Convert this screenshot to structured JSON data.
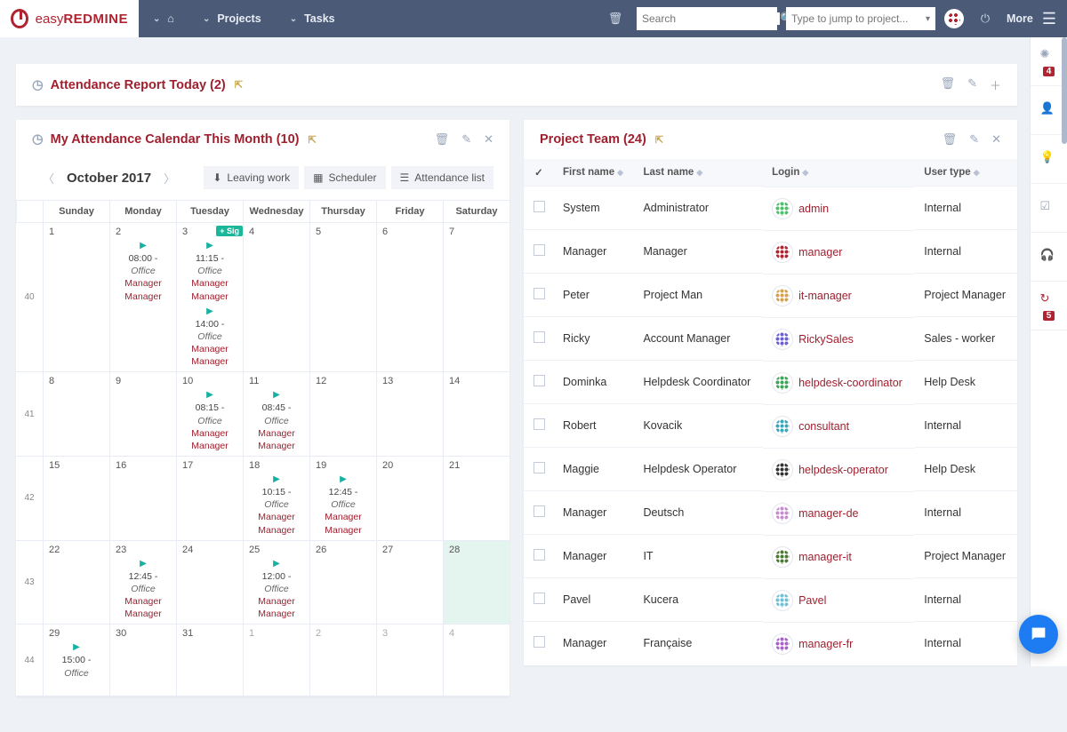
{
  "topbar": {
    "logo_easy": "easy",
    "logo_red": "REDMINE",
    "menu": [
      "Projects",
      "Tasks"
    ],
    "search_placeholder": "Search",
    "jump_placeholder": "Type to jump to project...",
    "more": "More"
  },
  "rightrail_badges": {
    "activity": "4",
    "time": "5"
  },
  "panelA": {
    "title": "Attendance Report Today (2)"
  },
  "panelCal": {
    "title": "My Attendance Calendar This Month (10)",
    "month": "October 2017",
    "btn_leaving": "Leaving work",
    "btn_scheduler": "Scheduler",
    "btn_list": "Attendance list",
    "dayhead": [
      "Sunday",
      "Monday",
      "Tuesday",
      "Wednesday",
      "Thursday",
      "Friday",
      "Saturday"
    ],
    "weeks": [
      {
        "wk": "40",
        "cells": [
          {
            "d": "1"
          },
          {
            "d": "2",
            "ev": [
              {
                "t": "08:00",
                "role": "Office",
                "who": "Manager Manager"
              }
            ]
          },
          {
            "d": "3",
            "pill": "+ Sig",
            "ev": [
              {
                "t": "11:15",
                "role": "Office",
                "who": "Manager Manager"
              },
              {
                "t": "14:00",
                "role": "Office",
                "who": "Manager Manager"
              }
            ]
          },
          {
            "d": "4"
          },
          {
            "d": "5"
          },
          {
            "d": "6"
          },
          {
            "d": "7"
          }
        ]
      },
      {
        "wk": "41",
        "cells": [
          {
            "d": "8"
          },
          {
            "d": "9"
          },
          {
            "d": "10",
            "ev": [
              {
                "t": "08:15",
                "role": "Office",
                "who": "Manager Manager"
              }
            ]
          },
          {
            "d": "11",
            "ev": [
              {
                "t": "08:45",
                "role": "Office",
                "who": "Manager Manager"
              }
            ]
          },
          {
            "d": "12"
          },
          {
            "d": "13"
          },
          {
            "d": "14"
          }
        ]
      },
      {
        "wk": "42",
        "cells": [
          {
            "d": "15"
          },
          {
            "d": "16"
          },
          {
            "d": "17"
          },
          {
            "d": "18",
            "ev": [
              {
                "t": "10:15",
                "role": "Office",
                "who": "Manager Manager"
              }
            ]
          },
          {
            "d": "19",
            "ev": [
              {
                "t": "12:45",
                "role": "Office",
                "who": "Manager Manager"
              }
            ]
          },
          {
            "d": "20"
          },
          {
            "d": "21"
          }
        ]
      },
      {
        "wk": "43",
        "cells": [
          {
            "d": "22"
          },
          {
            "d": "23",
            "ev": [
              {
                "t": "12:45",
                "role": "Office",
                "who": "Manager Manager"
              }
            ]
          },
          {
            "d": "24"
          },
          {
            "d": "25",
            "ev": [
              {
                "t": "12:00",
                "role": "Office",
                "who": "Manager Manager"
              }
            ]
          },
          {
            "d": "26"
          },
          {
            "d": "27"
          },
          {
            "d": "28",
            "fill": true
          }
        ]
      },
      {
        "wk": "44",
        "cells": [
          {
            "d": "29",
            "ev": [
              {
                "t": "15:00",
                "role": "Office",
                "who": ""
              }
            ]
          },
          {
            "d": "30"
          },
          {
            "d": "31"
          },
          {
            "d": "1",
            "past": true
          },
          {
            "d": "2",
            "past": true
          },
          {
            "d": "3",
            "past": true
          },
          {
            "d": "4",
            "past": true
          }
        ]
      }
    ]
  },
  "panelTeam": {
    "title": "Project Team (24)",
    "cols": {
      "first": "First name",
      "last": "Last name",
      "login": "Login",
      "type": "User type"
    },
    "rows": [
      {
        "first": "System",
        "last": "Administrator",
        "login": "admin",
        "type": "Internal",
        "c": "#4bbf6b"
      },
      {
        "first": "Manager",
        "last": "Manager",
        "login": "manager",
        "type": "Internal",
        "c": "#b02432"
      },
      {
        "first": "Peter",
        "last": "Project Man",
        "login": "it-manager",
        "type": "Project Manager",
        "c": "#d6a24d"
      },
      {
        "first": "Ricky",
        "last": "Account Manager",
        "login": "RickySales",
        "type": "Sales - worker",
        "c": "#6c5fd5"
      },
      {
        "first": "Dominka",
        "last": "Helpdesk Coordinator",
        "login": "helpdesk-coordinator",
        "type": "Help Desk",
        "c": "#3fa556"
      },
      {
        "first": "Robert",
        "last": "Kovacik",
        "login": "consultant",
        "type": "Internal",
        "c": "#3aa6b9"
      },
      {
        "first": "Maggie",
        "last": "Helpdesk Operator",
        "login": "helpdesk-operator",
        "type": "Help Desk",
        "c": "#333"
      },
      {
        "first": "Manager",
        "last": "Deutsch",
        "login": "manager-de",
        "type": "Internal",
        "c": "#c78bd0"
      },
      {
        "first": "Manager",
        "last": "IT",
        "login": "manager-it",
        "type": "Project Manager",
        "c": "#4a7a35"
      },
      {
        "first": "Pavel",
        "last": "Kucera",
        "login": "Pavel",
        "type": "Internal",
        "c": "#6fc1d6"
      },
      {
        "first": "Manager",
        "last": "Française",
        "login": "manager-fr",
        "type": "Internal",
        "c": "#a862c9"
      }
    ]
  }
}
